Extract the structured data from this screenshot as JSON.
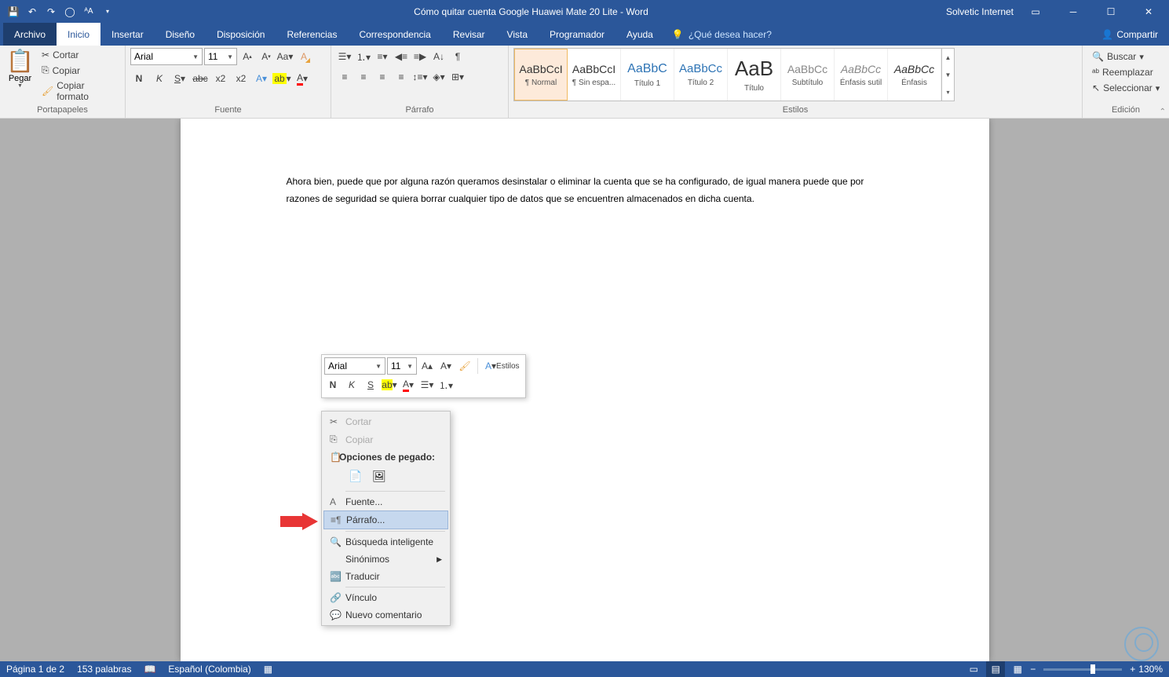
{
  "titlebar": {
    "title": "Cómo quitar cuenta Google Huawei Mate 20 Lite  -  Word",
    "account": "Solvetic Internet"
  },
  "tabs": {
    "file": "Archivo",
    "home": "Inicio",
    "insert": "Insertar",
    "design": "Diseño",
    "layout": "Disposición",
    "references": "Referencias",
    "mail": "Correspondencia",
    "review": "Revisar",
    "view": "Vista",
    "developer": "Programador",
    "help": "Ayuda",
    "tellme": "¿Qué desea hacer?",
    "share": "Compartir"
  },
  "ribbon": {
    "clipboard": {
      "label": "Portapapeles",
      "paste": "Pegar",
      "cut": "Cortar",
      "copy": "Copiar",
      "format_painter": "Copiar formato"
    },
    "font": {
      "label": "Fuente",
      "name": "Arial",
      "size": "11",
      "bold": "N",
      "italic": "K",
      "underline": "S"
    },
    "paragraph": {
      "label": "Párrafo"
    },
    "styles": {
      "label": "Estilos",
      "items": [
        {
          "preview": "AaBbCcI",
          "name": "¶ Normal"
        },
        {
          "preview": "AaBbCcI",
          "name": "¶ Sin espa..."
        },
        {
          "preview": "AaBbC",
          "name": "Título 1",
          "color": "#2e74b5",
          "size": "16px"
        },
        {
          "preview": "AaBbCc",
          "name": "Título 2",
          "color": "#2e74b5",
          "size": "15px"
        },
        {
          "preview": "AaB",
          "name": "Título",
          "size": "26px"
        },
        {
          "preview": "AaBbCc",
          "name": "Subtítulo",
          "color": "#888"
        },
        {
          "preview": "AaBbCc",
          "name": "Énfasis sutil",
          "color": "#888",
          "style": "italic"
        },
        {
          "preview": "AaBbCc",
          "name": "Énfasis",
          "style": "italic"
        }
      ]
    },
    "editing": {
      "label": "Edición",
      "find": "Buscar",
      "replace": "Reemplazar",
      "select": "Seleccionar"
    }
  },
  "document": {
    "text": "Ahora bien, puede que por alguna razón queramos desinstalar o eliminar la cuenta que se ha configurado, de igual manera puede que por razones de seguridad se quiera borrar cualquier tipo de datos que se encuentren almacenados en dicha cuenta."
  },
  "mini_toolbar": {
    "font": "Arial",
    "size": "11",
    "styles": "Estilos",
    "bold": "N",
    "italic": "K",
    "underline": "S"
  },
  "context_menu": {
    "cut": "Cortar",
    "copy": "Copiar",
    "paste_header": "Opciones de pegado:",
    "font": "Fuente...",
    "paragraph": "Párrafo...",
    "smart_lookup": "Búsqueda inteligente",
    "synonyms": "Sinónimos",
    "translate": "Traducir",
    "link": "Vínculo",
    "new_comment": "Nuevo comentario"
  },
  "statusbar": {
    "page": "Página 1 de 2",
    "words": "153 palabras",
    "lang": "Español (Colombia)",
    "zoom": "130%"
  }
}
